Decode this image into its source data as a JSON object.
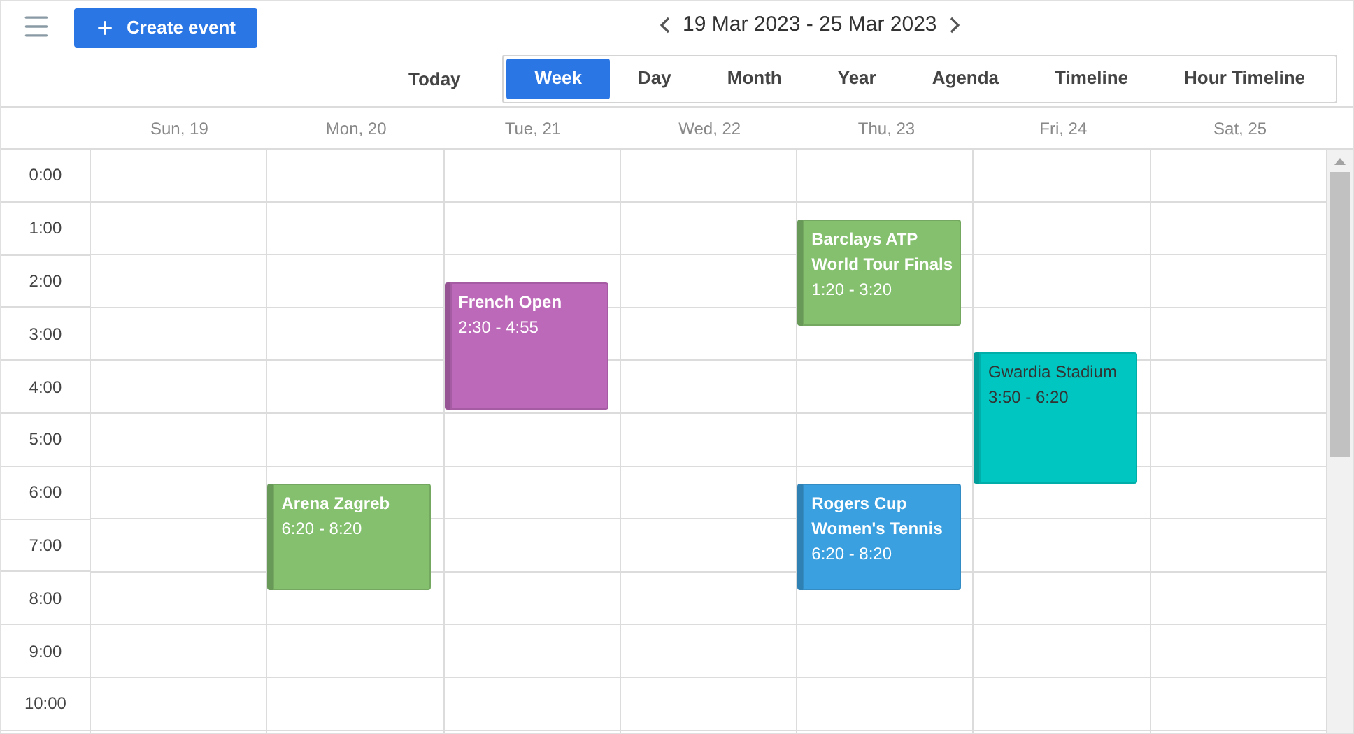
{
  "toolbar": {
    "create_button": "Create event",
    "date_range": "19 Mar 2023 - 25 Mar 2023"
  },
  "today_button": "Today",
  "views": [
    {
      "label": "Week",
      "selected": true
    },
    {
      "label": "Day",
      "selected": false
    },
    {
      "label": "Month",
      "selected": false
    },
    {
      "label": "Year",
      "selected": false
    },
    {
      "label": "Agenda",
      "selected": false
    },
    {
      "label": "Timeline",
      "selected": false
    },
    {
      "label": "Hour Timeline",
      "selected": false
    }
  ],
  "hours": [
    "0:00",
    "1:00",
    "2:00",
    "3:00",
    "4:00",
    "5:00",
    "6:00",
    "7:00",
    "8:00",
    "9:00",
    "10:00"
  ],
  "days": [
    {
      "label": "Sun, 19"
    },
    {
      "label": "Mon, 20",
      "events": [
        {
          "title": "Arena Zagreb",
          "time": "6:20 - 8:20",
          "color": "#84c06e",
          "dark_text": false
        }
      ]
    },
    {
      "label": "Tue, 21",
      "events": [
        {
          "title": "French Open",
          "time": "2:30 - 4:55",
          "color": "#bd69b9",
          "dark_text": false
        }
      ]
    },
    {
      "label": "Wed, 22"
    },
    {
      "label": "Thu, 23",
      "events": [
        {
          "title": "Barclays ATP World Tour Finals",
          "time": "1:20 - 3:20",
          "color": "#84c06e",
          "dark_text": false
        },
        {
          "title": "Rogers Cup Women's Tennis",
          "time": "6:20 - 8:20",
          "color": "#3ba0e0",
          "dark_text": false
        }
      ]
    },
    {
      "label": "Fri, 24",
      "events": [
        {
          "title": "Gwardia Stadium",
          "time": "3:50 - 6:20",
          "color": "#00c6c1",
          "dark_text": true
        }
      ]
    },
    {
      "label": "Sat, 25"
    }
  ]
}
